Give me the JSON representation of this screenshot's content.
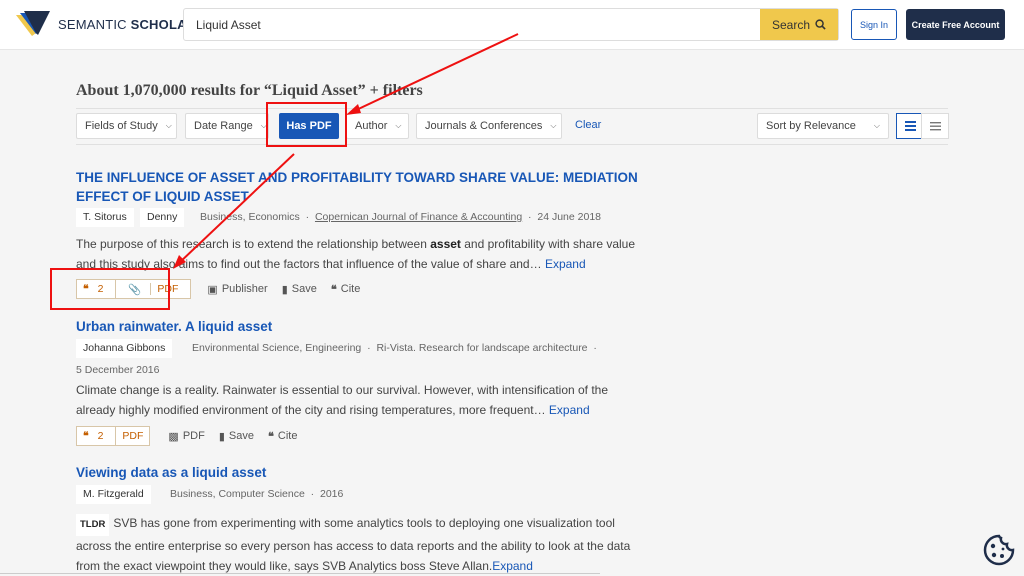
{
  "header": {
    "logo_text_light": "SEMANTIC",
    "logo_text_bold": "SCHOLAR",
    "search_value": "Liquid Asset",
    "search_label": "Search",
    "signin_label": "Sign In",
    "create_label": "Create Free Account"
  },
  "results_count_text": "About 1,070,000 results for “Liquid Asset” + filters",
  "filters": {
    "fields_of_study": "Fields of Study",
    "date_range": "Date Range",
    "has_pdf": "Has PDF",
    "author": "Author",
    "journals": "Journals & Conferences",
    "clear": "Clear",
    "sort": "Sort by Relevance"
  },
  "results": [
    {
      "title_line1": "THE INFLUENCE OF ASSET AND PROFITABILITY TOWARD SHARE VALUE: MEDIATION",
      "title_line2": "EFFECT OF LIQUID ASSET",
      "authors": [
        "T. Sitorus",
        "Denny"
      ],
      "fields": "Business, Economics",
      "venue": "Copernican Journal of Finance & Accounting",
      "date": "24 June 2018",
      "abstract_before": "The purpose of this research is to extend the relationship between ",
      "abstract_highlight": "asset",
      "abstract_after_line1": " and profitability with share value",
      "abstract_line2": "and this study also aims to find out the factors that influence of the value of share and…",
      "expand": "Expand",
      "citations": "2",
      "pdf": "PDF",
      "publisher": "Publisher",
      "save": "Save",
      "cite": "Cite"
    },
    {
      "title": "Urban rainwater. A liquid asset",
      "authors": [
        "Johanna Gibbons"
      ],
      "fields": "Environmental Science, Engineering",
      "venue": "Ri-Vista. Research for landscape architecture",
      "date": "5 December 2016",
      "abstract_line1": "Climate change is a reality. Rainwater is essential to our survival. However, with intensification of the",
      "abstract_line2": "already highly modified environment of the city and rising temperatures, more frequent…",
      "expand": "Expand",
      "citations": "2",
      "pdf_tag": "PDF",
      "pdf": "PDF",
      "save": "Save",
      "cite": "Cite"
    },
    {
      "title": "Viewing data as a liquid asset",
      "authors": [
        "M. Fitzgerald"
      ],
      "fields": "Business, Computer Science",
      "date": "2016",
      "tldr": "TLDR",
      "abstract_line1": "SVB has gone from experimenting with some analytics tools to deploying one visualization tool",
      "abstract_line2": "across the entire enterprise so every person has access to data reports and the ability to look at the data",
      "abstract_line3": "from the exact viewpoint they would like, says SVB Analytics boss Steve Allan.",
      "expand": "Expand"
    }
  ],
  "colors": {
    "link_blue": "#1857b6",
    "search_yellow": "#f0c84c",
    "navy": "#1f2e4a",
    "annotation_red": "#e11111",
    "citation_orange": "#c45f00"
  }
}
